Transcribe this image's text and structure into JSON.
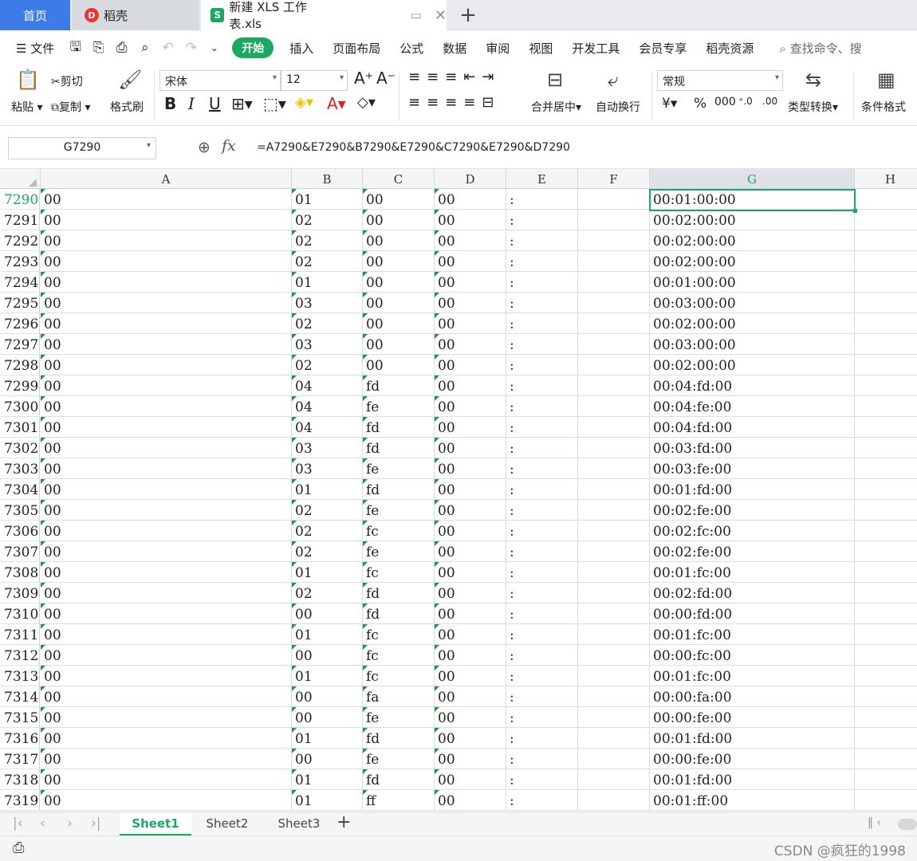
{
  "tabs": {
    "home": "首页",
    "docer": "稻壳",
    "file": "新建 XLS 工作表.xls",
    "new_tab": "+"
  },
  "menu": {
    "file": "文件",
    "items": [
      "开始",
      "插入",
      "页面布局",
      "公式",
      "数据",
      "审阅",
      "视图",
      "开发工具",
      "会员专享",
      "稻壳资源"
    ],
    "search": "查找命令、搜"
  },
  "ribbon": {
    "paste": "粘贴",
    "cut": "剪切",
    "copy": "复制",
    "format_painter": "格式刷",
    "font": "宋体",
    "size": "12",
    "merge": "合并居中",
    "wrap": "自动换行",
    "number_format": "常规",
    "convert": "类型转换",
    "conditional": "条件格式"
  },
  "name_box": "G7290",
  "fx_label": "fx",
  "formula": "=A7290&E7290&B7290&E7290&C7290&E7290&D7290",
  "columns": [
    "A",
    "B",
    "C",
    "D",
    "E",
    "F",
    "G",
    "H"
  ],
  "selected_col": "G",
  "rows": [
    {
      "n": "7290",
      "a": "00",
      "b": "01",
      "c": "00",
      "d": "00",
      "e": ":",
      "g": "00:01:00:00"
    },
    {
      "n": "7291",
      "a": "00",
      "b": "02",
      "c": "00",
      "d": "00",
      "e": ":",
      "g": "00:02:00:00"
    },
    {
      "n": "7292",
      "a": "00",
      "b": "02",
      "c": "00",
      "d": "00",
      "e": ":",
      "g": "00:02:00:00"
    },
    {
      "n": "7293",
      "a": "00",
      "b": "02",
      "c": "00",
      "d": "00",
      "e": ":",
      "g": "00:02:00:00"
    },
    {
      "n": "7294",
      "a": "00",
      "b": "01",
      "c": "00",
      "d": "00",
      "e": ":",
      "g": "00:01:00:00"
    },
    {
      "n": "7295",
      "a": "00",
      "b": "03",
      "c": "00",
      "d": "00",
      "e": ":",
      "g": "00:03:00:00"
    },
    {
      "n": "7296",
      "a": "00",
      "b": "02",
      "c": "00",
      "d": "00",
      "e": ":",
      "g": "00:02:00:00"
    },
    {
      "n": "7297",
      "a": "00",
      "b": "03",
      "c": "00",
      "d": "00",
      "e": ":",
      "g": "00:03:00:00"
    },
    {
      "n": "7298",
      "a": "00",
      "b": "02",
      "c": "00",
      "d": "00",
      "e": ":",
      "g": "00:02:00:00"
    },
    {
      "n": "7299",
      "a": "00",
      "b": "04",
      "c": "fd",
      "d": "00",
      "e": ":",
      "g": "00:04:fd:00"
    },
    {
      "n": "7300",
      "a": "00",
      "b": "04",
      "c": "fe",
      "d": "00",
      "e": ":",
      "g": "00:04:fe:00"
    },
    {
      "n": "7301",
      "a": "00",
      "b": "04",
      "c": "fd",
      "d": "00",
      "e": ":",
      "g": "00:04:fd:00"
    },
    {
      "n": "7302",
      "a": "00",
      "b": "03",
      "c": "fd",
      "d": "00",
      "e": ":",
      "g": "00:03:fd:00"
    },
    {
      "n": "7303",
      "a": "00",
      "b": "03",
      "c": "fe",
      "d": "00",
      "e": ":",
      "g": "00:03:fe:00"
    },
    {
      "n": "7304",
      "a": "00",
      "b": "01",
      "c": "fd",
      "d": "00",
      "e": ":",
      "g": "00:01:fd:00"
    },
    {
      "n": "7305",
      "a": "00",
      "b": "02",
      "c": "fe",
      "d": "00",
      "e": ":",
      "g": "00:02:fe:00"
    },
    {
      "n": "7306",
      "a": "00",
      "b": "02",
      "c": "fc",
      "d": "00",
      "e": ":",
      "g": "00:02:fc:00"
    },
    {
      "n": "7307",
      "a": "00",
      "b": "02",
      "c": "fe",
      "d": "00",
      "e": ":",
      "g": "00:02:fe:00"
    },
    {
      "n": "7308",
      "a": "00",
      "b": "01",
      "c": "fc",
      "d": "00",
      "e": ":",
      "g": "00:01:fc:00"
    },
    {
      "n": "7309",
      "a": "00",
      "b": "02",
      "c": "fd",
      "d": "00",
      "e": ":",
      "g": "00:02:fd:00"
    },
    {
      "n": "7310",
      "a": "00",
      "b": "00",
      "c": "fd",
      "d": "00",
      "e": ":",
      "g": "00:00:fd:00"
    },
    {
      "n": "7311",
      "a": "00",
      "b": "01",
      "c": "fc",
      "d": "00",
      "e": ":",
      "g": "00:01:fc:00"
    },
    {
      "n": "7312",
      "a": "00",
      "b": "00",
      "c": "fc",
      "d": "00",
      "e": ":",
      "g": "00:00:fc:00"
    },
    {
      "n": "7313",
      "a": "00",
      "b": "01",
      "c": "fc",
      "d": "00",
      "e": ":",
      "g": "00:01:fc:00"
    },
    {
      "n": "7314",
      "a": "00",
      "b": "00",
      "c": "fa",
      "d": "00",
      "e": ":",
      "g": "00:00:fa:00"
    },
    {
      "n": "7315",
      "a": "00",
      "b": "00",
      "c": "fe",
      "d": "00",
      "e": ":",
      "g": "00:00:fe:00"
    },
    {
      "n": "7316",
      "a": "00",
      "b": "01",
      "c": "fd",
      "d": "00",
      "e": ":",
      "g": "00:01:fd:00"
    },
    {
      "n": "7317",
      "a": "00",
      "b": "00",
      "c": "fe",
      "d": "00",
      "e": ":",
      "g": "00:00:fe:00"
    },
    {
      "n": "7318",
      "a": "00",
      "b": "01",
      "c": "fd",
      "d": "00",
      "e": ":",
      "g": "00:01:fd:00"
    },
    {
      "n": "7319",
      "a": "00",
      "b": "01",
      "c": "ff",
      "d": "00",
      "e": ":",
      "g": "00:01:ff:00"
    }
  ],
  "sheets": [
    "Sheet1",
    "Sheet2",
    "Sheet3"
  ],
  "active_sheet": "Sheet1",
  "watermark": "CSDN @疯狂的1998",
  "colors": {
    "accent": "#1aa864",
    "home_tab": "#3d7be6"
  }
}
